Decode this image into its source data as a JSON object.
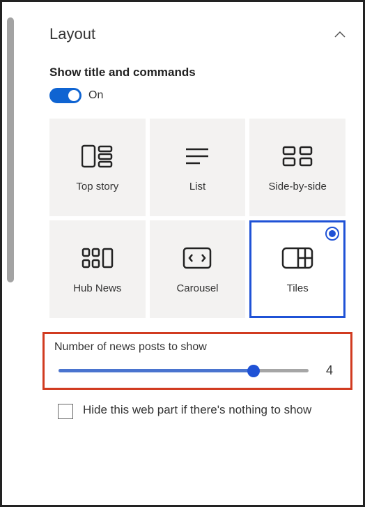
{
  "section": {
    "title": "Layout"
  },
  "toggle": {
    "label": "Show title and commands",
    "state": "On"
  },
  "layouts": {
    "topStory": "Top story",
    "list": "List",
    "sideBySide": "Side-by-side",
    "hubNews": "Hub News",
    "carousel": "Carousel",
    "tiles": "Tiles"
  },
  "slider": {
    "label": "Number of news posts to show",
    "value": "4"
  },
  "checkbox": {
    "label": "Hide this web part if there's nothing to show"
  }
}
